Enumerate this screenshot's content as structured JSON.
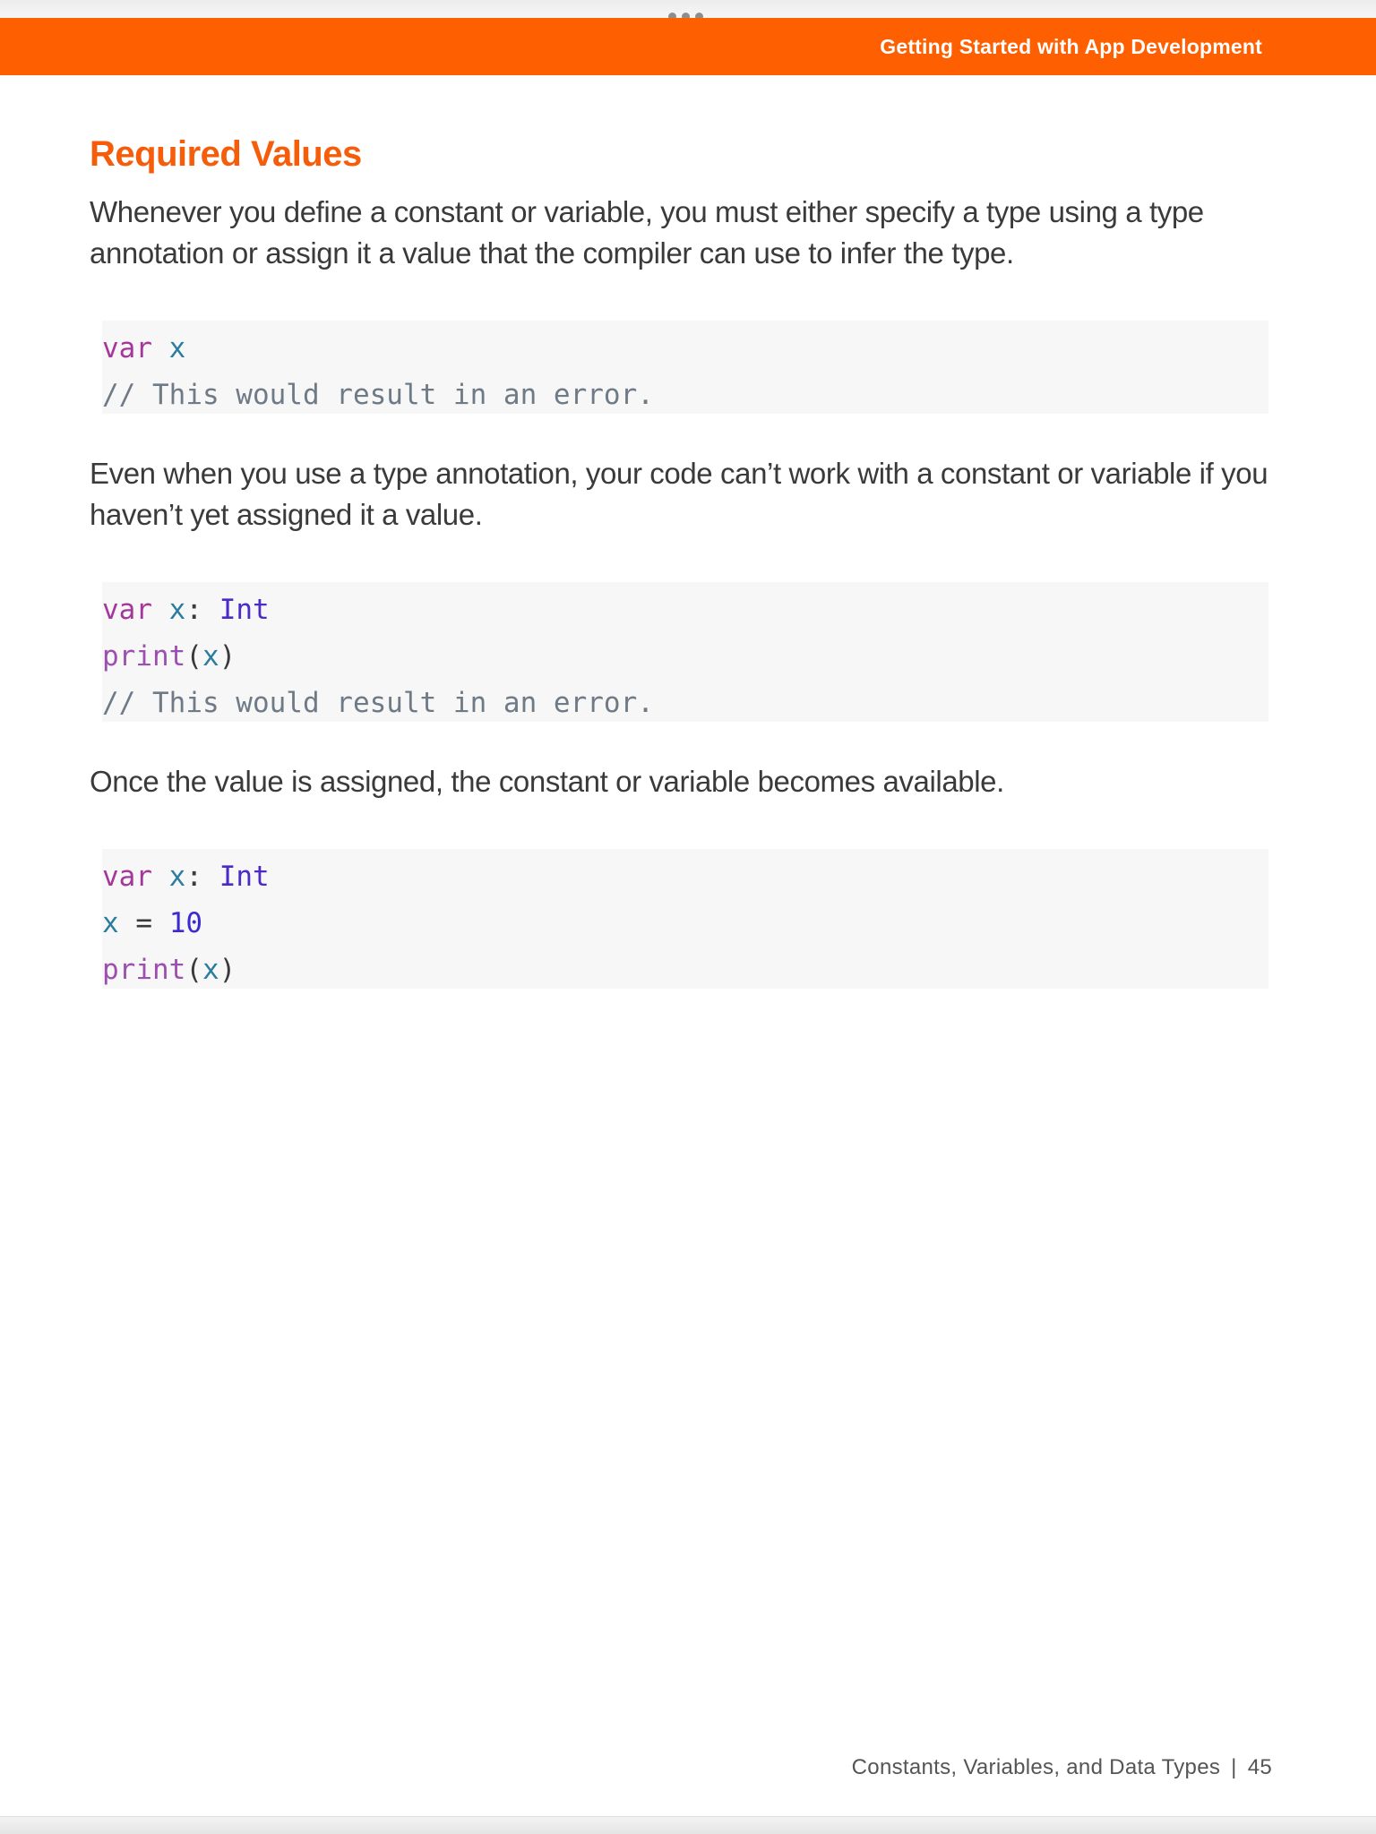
{
  "header": {
    "book_title": "Getting Started with App Development"
  },
  "section": {
    "heading": "Required Values",
    "paragraphs": [
      "Whenever you define a constant or variable, you must either specify a type using a type annotation or assign it a value that the compiler can use to infer the type.",
      "Even when you use a type annotation, your code can’t work with a constant or variable if you haven’t yet assigned it a value.",
      "Once the value is assigned, the constant or variable becomes available."
    ]
  },
  "code": {
    "block1": {
      "line1": {
        "kw": "var",
        "id": "x"
      },
      "line2": {
        "comment": "// This would result in an error."
      }
    },
    "block2": {
      "line1": {
        "kw": "var",
        "id": "x",
        "colon": ":",
        "type": "Int"
      },
      "line2": {
        "fn": "print",
        "open": "(",
        "arg": "x",
        "close": ")"
      },
      "line3": {
        "comment": "// This would result in an error."
      }
    },
    "block3": {
      "line1": {
        "kw": "var",
        "id": "x",
        "colon": ":",
        "type": "Int"
      },
      "line2": {
        "id": "x",
        "op": "=",
        "num": "10"
      },
      "line3": {
        "fn": "print",
        "open": "(",
        "arg": "x",
        "close": ")"
      }
    }
  },
  "footer": {
    "chapter": "Constants, Variables, and Data Types",
    "separator": "|",
    "page_number": "45"
  },
  "colors": {
    "brand_orange": "#fe5f01",
    "heading_orange": "#f55d0a",
    "code_background": "#f7f7f7",
    "keyword": "#a5379b",
    "identifier": "#2b7d9e",
    "type": "#4b2ac7",
    "comment": "#6f7a87"
  },
  "icons": {
    "top_handle": "more-dots-icon"
  }
}
